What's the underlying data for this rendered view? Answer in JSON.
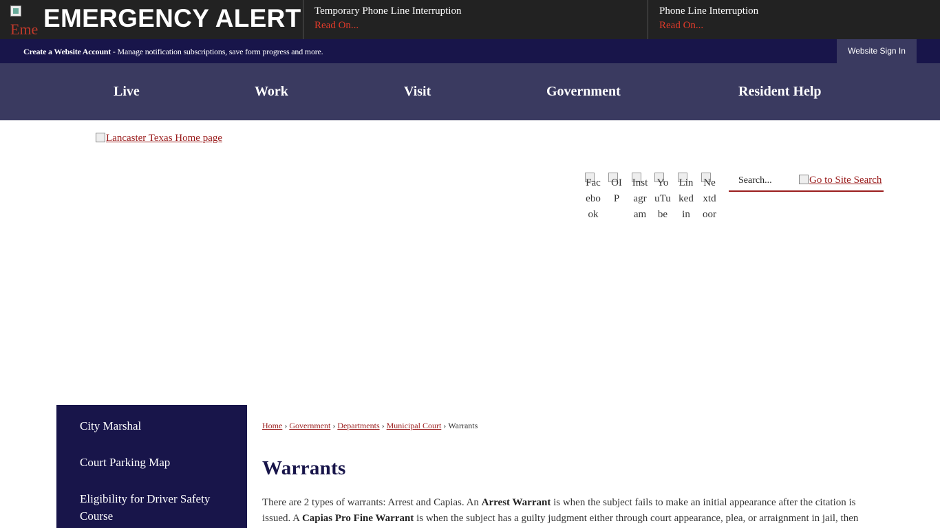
{
  "alert": {
    "icon_alt": "Emergency",
    "title": "EMERGENCY ALERT",
    "items": [
      {
        "title": "Temporary Phone Line Interruption",
        "link": "Read On..."
      },
      {
        "title": "Phone Line Interruption",
        "link": "Read On..."
      }
    ]
  },
  "account": {
    "create_label": "Create a Website Account",
    "description": " - Manage notification subscriptions, save form progress and more.",
    "sign_in": "Website Sign In"
  },
  "nav": [
    "Live",
    "Work",
    "Visit",
    "Government",
    "Resident Help"
  ],
  "header": {
    "logo_alt": "Lancaster Texas Home page",
    "social": [
      "Facebook",
      "OIP",
      "Instagram",
      "YouTube",
      "Linkedin",
      "Nextdoor"
    ],
    "search_placeholder": "Search...",
    "search_button": "Go to Site Search"
  },
  "sidebar": {
    "items": [
      "City Marshal",
      "Court Parking Map",
      "Eligibility for Driver Safety Course"
    ]
  },
  "breadcrumb": {
    "links": [
      "Home",
      "Government",
      "Departments",
      "Municipal Court"
    ],
    "current": "Warrants"
  },
  "page": {
    "title": "Warrants",
    "p1": "There are 2 types of warrants: Arrest and Capias. An ",
    "b1": "Arrest Warrant",
    "p2": " is when the subject fails to make an initial appearance after the citation is issued. A ",
    "b2": "Capias Pro Fine Warrant",
    "p3": " is when the subject has a guilty judgment either through court appearance, plea, or arraignment in jail, then"
  },
  "colors": {
    "alert_bg": "#222222",
    "navy": "#18154a",
    "nav_bg": "#3a3a60",
    "link_red": "#9a1c1c",
    "alert_red": "#e23b2a"
  }
}
